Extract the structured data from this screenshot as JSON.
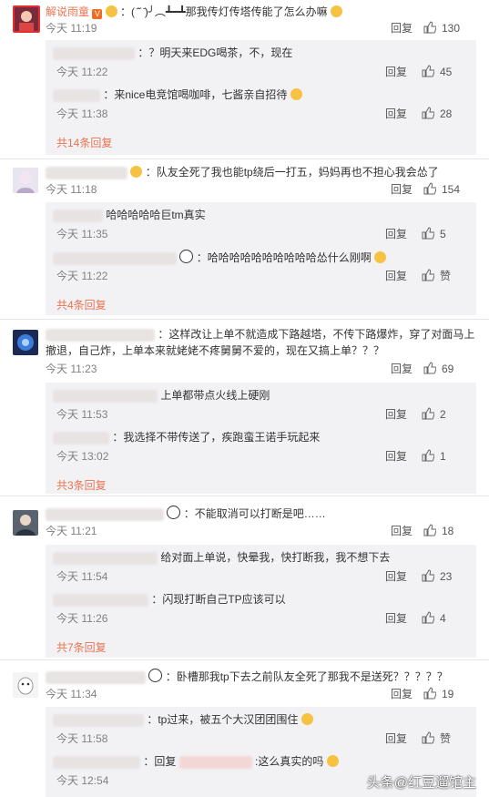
{
  "like_icon": "thumbs-up-icon",
  "reply_label": "回复",
  "comments": [
    {
      "author": "解说雨童",
      "text": "：( ̄ˇ ̄)╯︵┻━┻那我传灯传塔传能了怎么办嘛",
      "time": "今天 11:19",
      "likes": "130",
      "replies": [
        {
          "text": "：？明天来EDG喝茶，不，现在",
          "time": "今天 11:22",
          "likes": "45"
        },
        {
          "text": "：来nice电竞馆喝咖啡，七酱亲自招待",
          "time": "今天 11:38",
          "likes": "28"
        }
      ],
      "more": "共14条回复"
    },
    {
      "author": "",
      "text": "：队友全死了我也能tp绕后一打五，妈妈再也不担心我会怂了",
      "time": "今天 11:18",
      "likes": "154",
      "replies": [
        {
          "text": "哈哈哈哈哈巨tm真实",
          "time": "今天 11:35",
          "likes": "5"
        },
        {
          "text": "：哈哈哈哈哈哈哈哈哈哈怂什么刚啊",
          "time": "今天 11:22",
          "likes": "赞"
        }
      ],
      "more": "共4条回复"
    },
    {
      "author": "",
      "text": "：这样改让上单不就造成下路越塔，不传下路爆炸，穿了对面马上撤退，自己炸，上单本来就姥姥不疼舅舅不爱的，现在又搞上单？？？",
      "time": "今天 11:23",
      "likes": "69",
      "replies": [
        {
          "text": "上单都带点火线上硬刚",
          "time": "今天 11:53",
          "likes": "2"
        },
        {
          "text": "：我选择不带传送了，疾跑蛮王诺手玩起来",
          "time": "今天 13:02",
          "likes": "1"
        }
      ],
      "more": "共3条回复"
    },
    {
      "author": "",
      "text": "：不能取消可以打断是吧……",
      "time": "今天 11:21",
      "likes": "18",
      "replies": [
        {
          "text": "给对面上单说，快晕我，快打断我，我不想下去",
          "time": "今天 11:54",
          "likes": "23"
        },
        {
          "text": "：闪现打断自己TP应该可以",
          "time": "今天 11:26",
          "likes": "4"
        }
      ],
      "more": "共7条回复"
    },
    {
      "author": "",
      "text": "：卧槽那我tp下去之前队友全死了那我不是送死？？？？？",
      "time": "今天 11:34",
      "likes": "19",
      "replies": [
        {
          "text": "：tp过来，被五个大汉团团围住",
          "time": "今天 11:58",
          "likes": "赞"
        },
        {
          "text": "：回复",
          "text2": ":这么真实的吗",
          "time": "今天 12:54",
          "likes": ""
        }
      ],
      "more": ""
    }
  ],
  "watermark": "头条@红豆遛馆主"
}
